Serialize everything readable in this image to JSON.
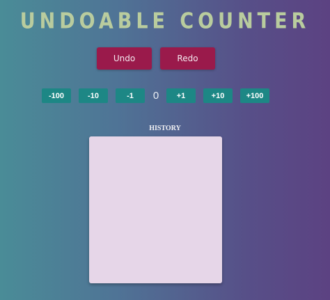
{
  "header": {
    "title": "UNDOABLE COUNTER"
  },
  "history_controls": {
    "undo_label": "Undo",
    "redo_label": "Redo"
  },
  "counter": {
    "value": "0",
    "decrements": [
      "-100",
      "-10",
      "-1"
    ],
    "increments": [
      "+1",
      "+10",
      "+100"
    ]
  },
  "history": {
    "label": "HISTORY",
    "entries": []
  },
  "colors": {
    "primary_button": "#9a1a4b",
    "step_button": "#1d8785",
    "title": "#b9cc9e",
    "history_panel": "#e6d6e8"
  }
}
